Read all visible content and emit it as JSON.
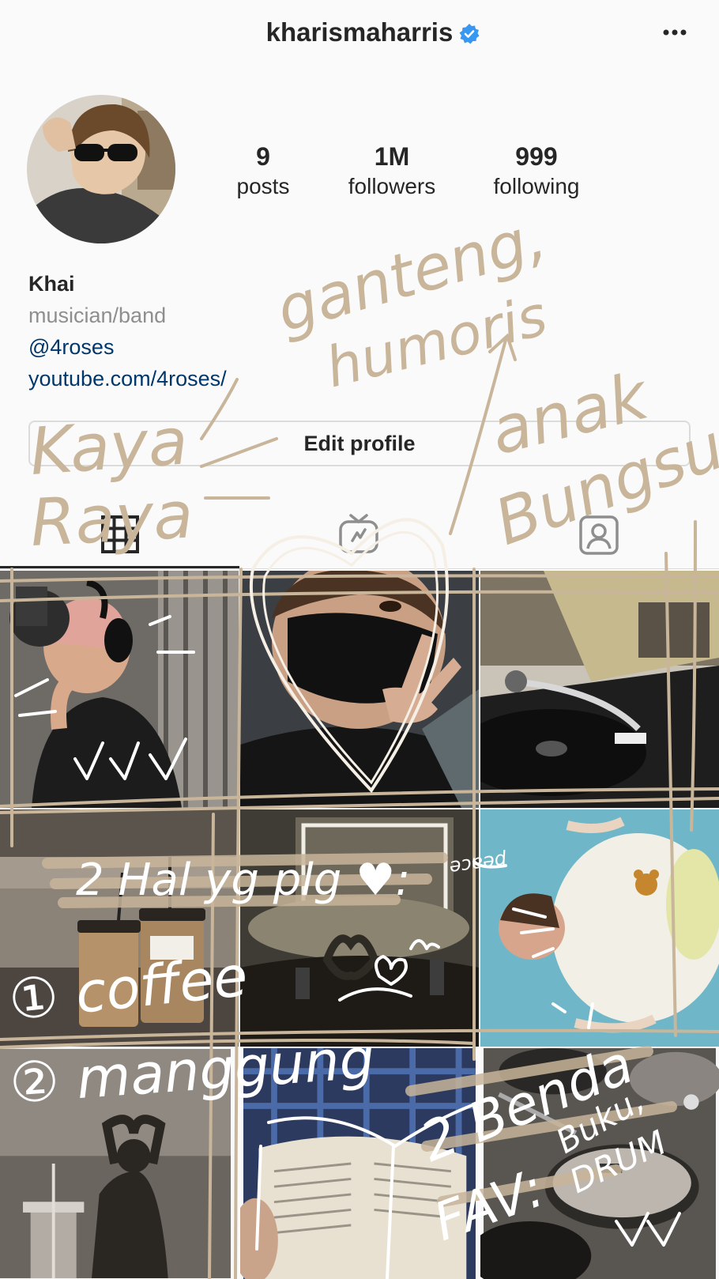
{
  "header": {
    "username": "kharismaharris",
    "verified_icon": "verified-badge-icon",
    "more_icon": "more-dots-icon"
  },
  "profile": {
    "stats": [
      {
        "value": "9",
        "label": "posts"
      },
      {
        "value": "1M",
        "label": "followers"
      },
      {
        "value": "999",
        "label": "following"
      }
    ],
    "name": "Khai",
    "category": "musician/band",
    "tag": "@4roses",
    "link": "youtube.com/4roses/",
    "edit_button": "Edit profile"
  },
  "tabs": [
    {
      "icon": "grid-icon",
      "active": true
    },
    {
      "icon": "igtv-icon",
      "active": false
    },
    {
      "icon": "tagged-icon",
      "active": false
    }
  ],
  "posts": [
    {
      "subject": "recording-studio-headphones"
    },
    {
      "subject": "mask-peace-sign"
    },
    {
      "subject": "turntable-record"
    },
    {
      "subject": "coffee-cups"
    },
    {
      "subject": "concert-heart-hands"
    },
    {
      "subject": "flower-pool"
    },
    {
      "subject": "silhouette-heart"
    },
    {
      "subject": "reading-book"
    },
    {
      "subject": "drum-kit"
    }
  ],
  "handwriting": {
    "ganteng": "ganteng,",
    "humoris": "humoris",
    "kaya": "Kaya",
    "raya": "Raya",
    "anak": "anak",
    "bungsu": "Bungsu",
    "hal_yg_plg": "2 Hal yg plg ♥:",
    "coffee": "① coffee",
    "manggung": "② manggung",
    "benda": "2 Benda",
    "fav": "FAV:",
    "buku": "Buku,",
    "drum": "DRUM",
    "peace": "peace"
  },
  "colors": {
    "ink_tan": "#c8b59a",
    "ink_white": "#ffffff",
    "link_blue": "#00376b",
    "verified_blue": "#3897f0"
  }
}
